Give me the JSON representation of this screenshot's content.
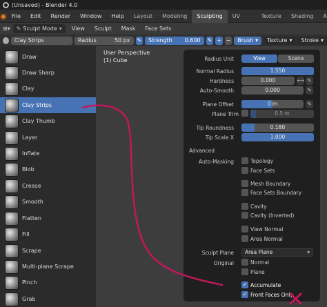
{
  "window": {
    "title": "(Unsaved) - Blender 4.0"
  },
  "menu": {
    "items": [
      "File",
      "Edit",
      "Render",
      "Window",
      "Help"
    ]
  },
  "workspaces": [
    "Layout",
    "Modeling",
    "Sculpting",
    "UV Editing",
    "Texture Paint",
    "Shading",
    "Animatio"
  ],
  "active_workspace": "Sculpting",
  "header": {
    "mode": "Sculpt Mode",
    "menus": [
      "View",
      "Sculpt",
      "Mask",
      "Face Sets"
    ]
  },
  "toolsettings": {
    "brush_name": "Clay Strips",
    "radius_label": "Radius",
    "radius_value": "50 px",
    "strength_label": "Strength",
    "strength_value": "0.600",
    "brush_menu": "Brush",
    "texture_menu": "Texture",
    "stroke_menu": "Stroke"
  },
  "tools": [
    "Draw",
    "Draw Sharp",
    "Clay",
    "Clay Strips",
    "Clay Thumb",
    "Layer",
    "Inflate",
    "Blob",
    "Crease",
    "Smooth",
    "Flatten",
    "Fill",
    "Scrape",
    "Multi-plane Scrape",
    "Pinch",
    "Grab"
  ],
  "active_tool": "Clay Strips",
  "viewport": {
    "perspective": "User Perspective",
    "object": "(1) Cube"
  },
  "panel": {
    "radius_unit_label": "Radius Unit",
    "radius_unit_view": "View",
    "radius_unit_scene": "Scene",
    "normal_radius_label": "Normal Radius",
    "normal_radius_value": "1.550",
    "hardness_label": "Hardness",
    "hardness_value": "0.000",
    "hardness_fill": 0.0,
    "auto_smooth_label": "Auto-Smooth",
    "auto_smooth_value": "0.000",
    "plane_offset_label": "Plane Offset",
    "plane_offset_value": "0 m",
    "plane_trim_label": "Plane Trim",
    "plane_trim_value": "0.5 m",
    "tip_roundness_label": "Tip Roundness",
    "tip_roundness_value": "0.180",
    "tip_roundness_fill": 0.18,
    "tip_scale_x_label": "Tip Scale X",
    "tip_scale_x_value": "1.000",
    "advanced_label": "Advanced",
    "auto_masking_label": "Auto-Masking",
    "auto_masking": [
      "Topology",
      "Face Sets",
      "Mesh Boundary",
      "Face Sets Boundary",
      "Cavity",
      "Cavity (Inverted)",
      "View Normal",
      "Area Normal"
    ],
    "sculpt_plane_label": "Sculpt Plane",
    "sculpt_plane_value": "Area Plane",
    "original_label": "Original",
    "original_opts": [
      "Normal",
      "Plane"
    ],
    "accumulate_label": "Accumulate",
    "front_faces_label": "Front Faces Only"
  },
  "colors": {
    "accent": "#4772b3",
    "annotation": "#c2185b"
  }
}
